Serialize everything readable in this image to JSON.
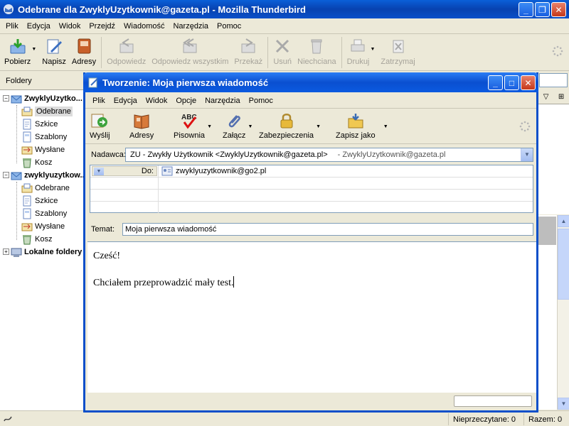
{
  "main": {
    "title": "Odebrane dla ZwyklyUzytkownik@gazeta.pl - Mozilla Thunderbird",
    "menu": [
      "Plik",
      "Edycja",
      "Widok",
      "Przejdź",
      "Wiadomość",
      "Narzędzia",
      "Pomoc"
    ],
    "toolbar": {
      "pobierz": "Pobierz",
      "napisz": "Napisz",
      "adresy": "Adresy",
      "odpowiedz": "Odpowiedz",
      "odpowiedz_wszystkim": "Odpowiedz wszystkim",
      "przekaz": "Przekaż",
      "usun": "Usuń",
      "niechciana": "Niechciana",
      "drukuj": "Drukuj",
      "zatrzymaj": "Zatrzymaj"
    },
    "folders_header": "Foldery",
    "accounts": [
      {
        "name": "ZwyklyUzytko...",
        "folders": [
          "Odebrane",
          "Szkice",
          "Szablony",
          "Wysłane",
          "Kosz"
        ]
      },
      {
        "name": "zwyklyuzytkow...",
        "folders": [
          "Odebrane",
          "Szkice",
          "Szablony",
          "Wysłane",
          "Kosz"
        ]
      }
    ],
    "local_folders": "Lokalne foldery",
    "status": {
      "unread": "Nieprzeczytane: 0",
      "total": "Razem: 0"
    }
  },
  "compose": {
    "title": "Tworzenie: Moja pierwsza wiadomość",
    "menu": [
      "Plik",
      "Edycja",
      "Widok",
      "Opcje",
      "Narzędzia",
      "Pomoc"
    ],
    "toolbar": {
      "wyslij": "Wyślij",
      "adresy": "Adresy",
      "pisownia": "Pisownia",
      "zalacz": "Załącz",
      "zabezpieczenia": "Zabezpieczenia",
      "zapisz_jako": "Zapisz jako"
    },
    "spell_badge": "ABC",
    "from_label": "Nadawca:",
    "from_value": "ZU - Zwykły Użytkownik <ZwyklyUzytkownik@gazeta.pl>",
    "from_account": "- ZwyklyUzytkownik@gazeta.pl",
    "recipient_type": "Do:",
    "recipient": "zwyklyuzytkownik@go2.pl",
    "subject_label": "Temat:",
    "subject_value": "Moja pierwsza wiadomość",
    "body": {
      "line1": "Cześć!",
      "line2": "Chciałem przeprowadzić mały test."
    }
  }
}
